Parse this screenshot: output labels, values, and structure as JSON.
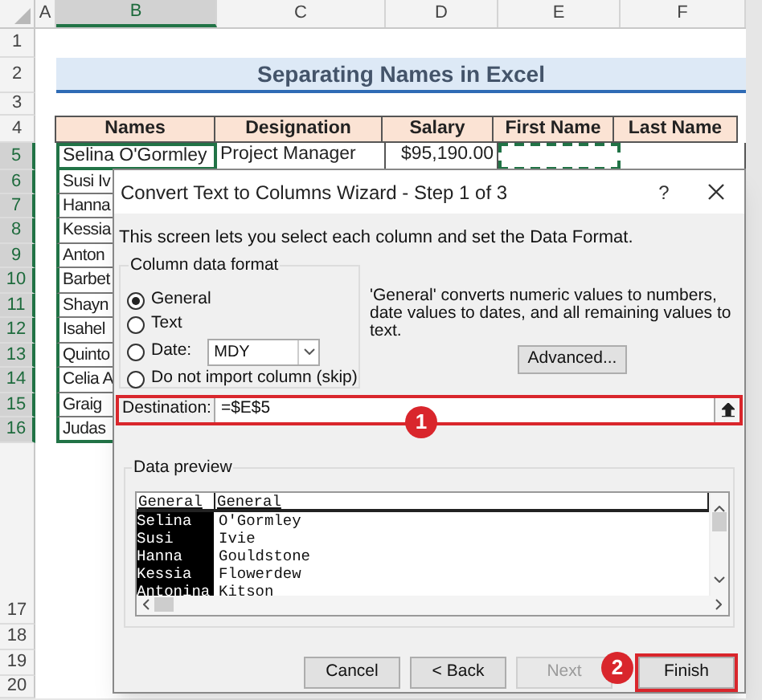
{
  "sheet": {
    "column_headers": [
      {
        "label": "A",
        "selected": false
      },
      {
        "label": "B",
        "selected": true
      },
      {
        "label": "C",
        "selected": false
      },
      {
        "label": "D",
        "selected": false
      },
      {
        "label": "E",
        "selected": false
      },
      {
        "label": "F",
        "selected": false
      }
    ],
    "row_numbers": [
      {
        "label": "1",
        "selected": false
      },
      {
        "label": "2",
        "selected": false
      },
      {
        "label": "3",
        "selected": false
      },
      {
        "label": "4",
        "selected": false
      },
      {
        "label": "5",
        "selected": true
      },
      {
        "label": "6",
        "selected": true
      },
      {
        "label": "7",
        "selected": true
      },
      {
        "label": "8",
        "selected": true
      },
      {
        "label": "9",
        "selected": true
      },
      {
        "label": "10",
        "selected": true
      },
      {
        "label": "11",
        "selected": true
      },
      {
        "label": "12",
        "selected": true
      },
      {
        "label": "13",
        "selected": true
      },
      {
        "label": "14",
        "selected": true
      },
      {
        "label": "15",
        "selected": true
      },
      {
        "label": "16",
        "selected": true
      },
      {
        "label": "17",
        "selected": false
      },
      {
        "label": "18",
        "selected": false
      },
      {
        "label": "19",
        "selected": false
      },
      {
        "label": "20",
        "selected": false
      }
    ],
    "title": "Separating Names in Excel",
    "table": {
      "columns": [
        "Names",
        "Designation",
        "Salary",
        "First Name",
        "Last Name"
      ],
      "first_row": {
        "name": "Selina O'Gormley",
        "designation": "Project Manager",
        "salary": "$95,190.00"
      },
      "partial_names": [
        "Susi Iv",
        "Hanna",
        "Kessia",
        "Anton",
        "Barbet",
        "Shayn",
        "Isahel",
        "Quinto",
        "Celia A",
        "Graig",
        "Judas"
      ]
    }
  },
  "dialog": {
    "title": "Convert Text to Columns Wizard - Step 1 of 3",
    "help": "?",
    "instruction": "This screen lets you select each column and set the Data Format.",
    "format_group": {
      "label": "Column data format",
      "date_format": "MDY",
      "options": [
        {
          "label": "General",
          "kind": "plain",
          "selected": true
        },
        {
          "label": "Text",
          "kind": "plain",
          "selected": false
        },
        {
          "label": "Date:",
          "kind": "date",
          "selected": false
        },
        {
          "label": "Do not import column (skip)",
          "kind": "plain",
          "selected": false
        }
      ]
    },
    "description": "'General' converts numeric values to numbers, date values to dates, and all remaining values to text.",
    "advanced_button": "Advanced...",
    "destination": {
      "label": "Destination:",
      "value": "=$E$5"
    },
    "preview": {
      "label": "Data preview",
      "columns": [
        {
          "header": "General",
          "selected": true,
          "values": [
            "Selina",
            "Susi",
            "Hanna",
            "Kessia",
            "Antonina"
          ]
        },
        {
          "header": "General",
          "selected": false,
          "values": [
            "O'Gormley",
            "Ivie",
            "Gouldstone",
            "Flowerdew",
            "Kitson"
          ]
        }
      ]
    },
    "buttons": [
      {
        "label": "Cancel",
        "disabled": false,
        "highlighted": false
      },
      {
        "label": "< Back",
        "disabled": false,
        "highlighted": false
      },
      {
        "label": "Next",
        "disabled": true,
        "highlighted": false
      },
      {
        "label": "Finish",
        "disabled": false,
        "highlighted": true
      }
    ]
  },
  "callouts": [
    "1",
    "2"
  ]
}
